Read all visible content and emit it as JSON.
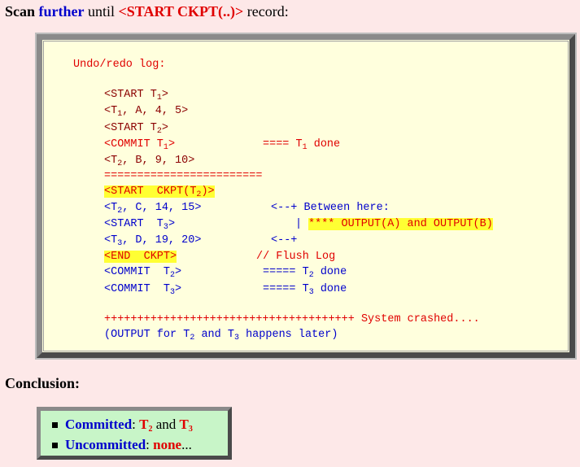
{
  "heading": {
    "scan": "Scan",
    "further": "further",
    "until": " until ",
    "record_tag": "<START CKPT(..)>",
    "record": " record:"
  },
  "log": {
    "title": "Undo/redo log:",
    "l1": "<START T",
    "l1_sub": "1",
    "l1_end": ">",
    "l2_pre": "<T",
    "l2_sub": "1",
    "l2_end": ", A, 4, 5>",
    "l3": "<START T",
    "l3_sub": "2",
    "l3_end": ">",
    "l4": "<COMMIT T",
    "l4_sub": "1",
    "l4_end": ">",
    "l4_note_pre": "==== T",
    "l4_note_sub": "1",
    "l4_note_end": " done",
    "l5_pre": "<T",
    "l5_sub": "2",
    "l5_end": ", B, 9, 10>",
    "separator": "========================",
    "ckpt_pre": "<START  CKPT(T",
    "ckpt_sub": "2",
    "ckpt_end": ")>",
    "l7_pre": "<T",
    "l7_sub": "2",
    "l7_end": ", C, 14, 15>",
    "l7_note": "<--+ Between here:",
    "l8_pre": "<START  T",
    "l8_sub": "3",
    "l8_end": ">",
    "l8_bar": "|",
    "l8_note": "**** OUTPUT(A) and OUTPUT(B)",
    "l9_pre": "<T",
    "l9_sub": "3",
    "l9_end": ", D, 19, 20>",
    "l9_note": "<--+",
    "end_ckpt": "<END  CKPT>",
    "flush": "// Flush Log",
    "c2_pre": "<COMMIT  T",
    "c2_sub": "2",
    "c2_end": ">",
    "c2_note_pre": "===== T",
    "c2_note_sub": "2",
    "c2_note_end": " done",
    "c3_pre": "<COMMIT  T",
    "c3_sub": "3",
    "c3_end": ">",
    "c3_note_pre": "===== T",
    "c3_note_sub": "3",
    "c3_note_end": " done",
    "crash_line": "++++++++++++++++++++++++++++++++++++++ System crashed....",
    "later_pre": "(OUTPUT for T",
    "later_sub1": "2",
    "later_mid": " and T",
    "later_sub2": "3",
    "later_end": " happens later)"
  },
  "conclusion": {
    "title": "Conclusion:",
    "committed_label": "Committed",
    "colon1": ": ",
    "t2": "T",
    "t2_sub": "2",
    "and": " and ",
    "t3": "T",
    "t3_sub": "3",
    "uncommitted_label": "Uncommitted",
    "colon2": ": ",
    "none": "none",
    "ellipsis": "..."
  },
  "colors": {
    "background": "#fde8e8",
    "log_background": "#ffffdd",
    "conclusion_background": "#c8f5c8",
    "highlight": "#ffff33",
    "blue": "#0000cc",
    "red": "#e00000",
    "dark_red": "#8b0000"
  }
}
